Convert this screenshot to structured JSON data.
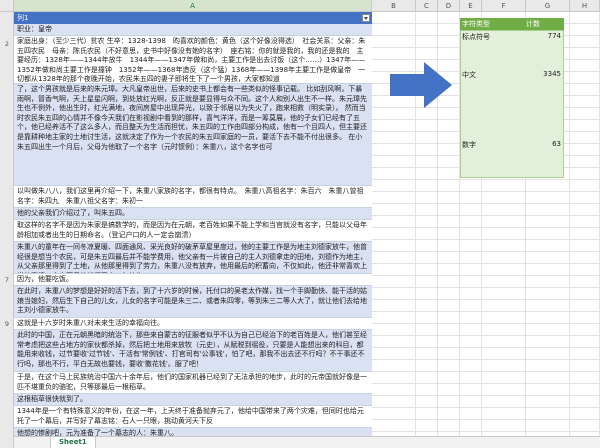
{
  "columns": [
    "A",
    "B",
    "C",
    "D",
    "E",
    "F",
    "G",
    "H"
  ],
  "table_header": "列1",
  "rows": [
    {
      "num": "",
      "text": "职业：皇帝"
    },
    {
      "num": "2",
      "text": "家庭出身：（至少三代）贫农 生卒：1328-1398　昀喜欢的颜色：黄色（这个好像没得选）　社会关系：父亲：朱五四农民　母亲：陈氏农民（不好意思，史书中好像没有她的名字）　座右铭：你的就是我的，我的还是我的　主要经历：1328年——1344年放牛　1344年——1347年做和尚，主要工作是出去讨饭（这个……）1347年——1352年做和尚主要工作是撞钟　1352年——1368年造反（这个猛）1368年——1398年主要工作是做皇帝　一切都从1328年的那个夜晚开始，农民朱五四的妻子即将生下了一个男孩，大家都知道"
    },
    {
      "num": "",
      "text": "了，这个男孩就是后来的朱元璋。大凡皇帝出世，后来的史书上都会有一些类似的怪事记载。 比如刮风啊，下暴雨啊，冒香气啊，天上星星闪啊，到处放红光啊，反正就是要显得与众不同。这个人和别人出生不一样。朱元璋先生也不例外，他出生时，红光满地，夜间房屋中出现异光，以致于邻居以为失火了，跑来相救（明实录）。 然而当时农民朱五四的心情并不像今天我们在影视剧中看到的那样，喜气洋洋，而是一筹莫展，他的子女们已经有了五个，他已经养活不了这么多人，而且整天为生活而担忧，朱五四的工作由四部分构成，他有一个且四人，但主要还是靠耕种地主家的土地讨生活，这就决定了作为一个农民的朱五四家庭的一员，要活下去不能不付出很多。 在小朱五四出生一个月后，父母为他取了一个名字（元时惯例）：朱重八，这个名字也可"
    },
    {
      "num": "",
      "text": "以叫做朱八八，我们这里再介绍一下，朱重八家族的名字，都很有特点。　朱重八高祖名字：朱百六　朱重八曾祖名字：朱四九　朱重八祖父名字：朱初一"
    },
    {
      "num": "",
      "text": "他的父亲我们介绍过了，叫朱五四。"
    },
    {
      "num": "",
      "text": "取这样的名字不是因为朱家是搞数学的，而是因为在元朝，老百姓如果不能上学和当官就没有名字，只能以父母年龄相加或者出生的日期命名。（登记户口的人一定会崩溃）"
    },
    {
      "num": "",
      "text": "朱重八的童年在一间冬凉夏暖、四面通风、采光良好的破茅草屋里度过，他的主要工作是为地主刘德家放牛，他曾经很是想当个农民，可是朱五四最后并不能学费用，他父亲有一片被自己的主人刘德拿走的田地，刘德作为地主，从父亲那里得到了土地，从他那里得到了劳力，朱重八没有放弃，他用最后的积蓄向，不仅如此，他还非常喜欢上学的事情，大夫死后他就留了十二年的牛。"
    },
    {
      "num": "7",
      "text": "因为，他要吃饭。"
    },
    {
      "num": "",
      "text": "在此时，朱重八的梦想是好好的活下去，到了十六岁的时候，托付口的吴老太作媒，找一个手脚勤快、能干活的姑娘当媳妇，然后生下自己的儿女，儿女的名字可能是朱三二、或者朱四零，等到朱三二等人大了，就让他们去给地主刘小德家放牛。"
    },
    {
      "num": "9",
      "text": "这就是十六岁时朱重八对未来生活的幸福向往。"
    },
    {
      "num": "",
      "text": "此时的中国，正在元朝黑暗的统治下，那些来自蒙古的征服者似乎不认为自己已经治下的老百姓是人，他们甚至经常考虑把这些占地方的家伙都杀掉，然后把土地用来放牧（元史），从赋税到徭役，只要是人能想出来的科目，都能用来收钱，过节要收'过节钱'、干活有'常例钱'、打官司有'公事钱'，怕了吧，那我不出去还不行吗？不干事还不行吗，那也不行，平白无故也要钱，要收'撒花钱'。服了吧！"
    },
    {
      "num": "",
      "text": "于是，在这个马上民族统治中国六十余年后，他们的国家机器已经到了无法承担的地步，此时的元帝国就好像是一匹不堪重负的骆驼，只等那最后一根稻草。"
    },
    {
      "num": "",
      "text": "这根稻草很快就到了。"
    },
    {
      "num": "",
      "text": "1344年是一个有特殊意义的年份，在这一年，上天终于准备抛弃元了，他给中国带来了两个灾难，但同时也给元托了一个幕后，并写好了幕志铭：石人一只眼，挑动黄河天下反"
    },
    {
      "num": "",
      "text": "他想的惨剧吧，元为准备了一个墓志的人：朱重八。"
    },
    {
      "num": "",
      "text": "当然朱重八不会想到上天会交给他这样一个重要的任务。"
    },
    {
      "num": "",
      "text": "这一年，他十七岁。"
    }
  ],
  "pivot": {
    "header": [
      "字符类型",
      "计数"
    ],
    "rows": [
      {
        "label": "标点符号",
        "count": "774"
      },
      {
        "label": "中文",
        "count": "3345"
      },
      {
        "label": "数字",
        "count": "63"
      }
    ]
  },
  "sheet_tab": "Sheet1",
  "colors": {
    "table_header": "#4472c4",
    "band": "#d9e1f2",
    "pivot_header": "#70ad47",
    "pivot_body": "#e2efda",
    "arrow": "#4472c4"
  }
}
